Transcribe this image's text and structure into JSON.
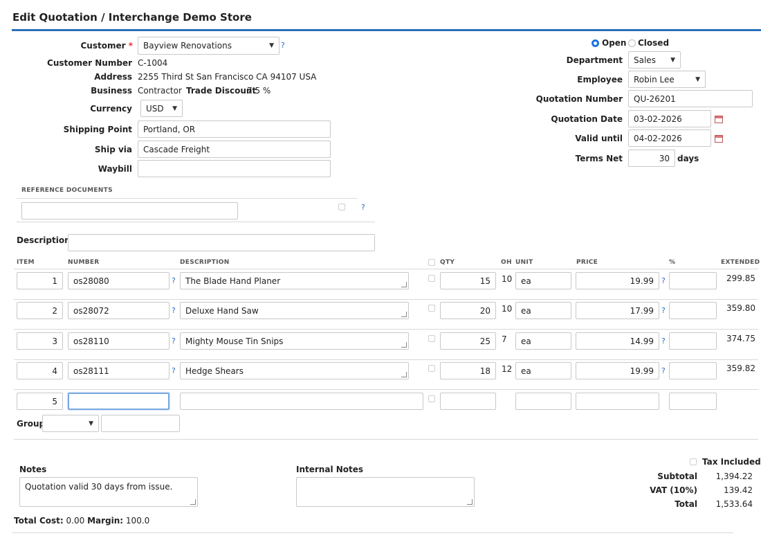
{
  "page": {
    "title": "Edit Quotation / Interchange Demo Store"
  },
  "customer": {
    "label": "Customer",
    "required_mark": "*",
    "value": "Bayview Renovations",
    "number_label": "Customer Number",
    "number": "C-1004",
    "address_label": "Address",
    "address": "2255 Third St San Francisco CA 94107 USA",
    "business_label": "Business",
    "business": "Contractor",
    "trade_discount_label": "Trade Discount",
    "trade_discount": "7.5 %",
    "currency_label": "Currency",
    "currency": "USD",
    "shipping_point_label": "Shipping Point",
    "shipping_point": "Portland, OR",
    "ship_via_label": "Ship via",
    "ship_via": "Cascade Freight",
    "waybill_label": "Waybill",
    "waybill": ""
  },
  "help_mark": "?",
  "status": {
    "open_label": "Open",
    "closed_label": "Closed",
    "selected": "Open"
  },
  "right": {
    "department_label": "Department",
    "department": "Sales",
    "employee_label": "Employee",
    "employee": "Robin Lee",
    "quote_number_label": "Quotation Number",
    "quote_number": "QU-26201",
    "quote_date_label": "Quotation Date",
    "quote_date": "03-02-2026",
    "valid_until_label": "Valid until",
    "valid_until": "04-02-2026",
    "terms_label": "Terms Net",
    "terms": "30",
    "terms_unit": "days"
  },
  "reference": {
    "header": "REFERENCE DOCUMENTS"
  },
  "description": {
    "label": "Description",
    "value": ""
  },
  "lines": {
    "headers": {
      "item": "ITEM",
      "number": "NUMBER",
      "description": "DESCRIPTION",
      "qty": "QTY",
      "oh": "OH",
      "unit": "UNIT",
      "price": "PRICE",
      "pct": "%",
      "extended": "EXTENDED"
    },
    "rows": [
      {
        "item": "1",
        "number": "os28080",
        "description": "The Blade Hand Planer",
        "qty": "15",
        "oh": "10",
        "unit": "ea",
        "price": "19.99",
        "pct": "",
        "extended": "299.85"
      },
      {
        "item": "2",
        "number": "os28072",
        "description": "Deluxe Hand Saw",
        "qty": "20",
        "oh": "10",
        "unit": "ea",
        "price": "17.99",
        "pct": "",
        "extended": "359.80"
      },
      {
        "item": "3",
        "number": "os28110",
        "description": "Mighty Mouse Tin Snips",
        "qty": "25",
        "oh": "7",
        "unit": "ea",
        "price": "14.99",
        "pct": "",
        "extended": "374.75"
      },
      {
        "item": "4",
        "number": "os28111",
        "description": "Hedge Shears",
        "qty": "18",
        "oh": "12",
        "unit": "ea",
        "price": "19.99",
        "pct": "",
        "extended": "359.82"
      }
    ],
    "new_row": {
      "item": "5"
    },
    "group_label": "Group"
  },
  "notes": {
    "label": "Notes",
    "value": "Quotation valid 30 days from issue.",
    "internal_label": "Internal Notes",
    "internal_value": ""
  },
  "totals": {
    "tax_included_label": "Tax Included",
    "subtotal_label": "Subtotal",
    "subtotal": "1,394.22",
    "vat_label": "VAT (10%)",
    "vat": "139.42",
    "total_label": "Total",
    "total": "1,533.64"
  },
  "footer": {
    "total_cost_label": "Total Cost:",
    "total_cost": "0.00",
    "margin_label": "Margin:",
    "margin": "100.0"
  }
}
